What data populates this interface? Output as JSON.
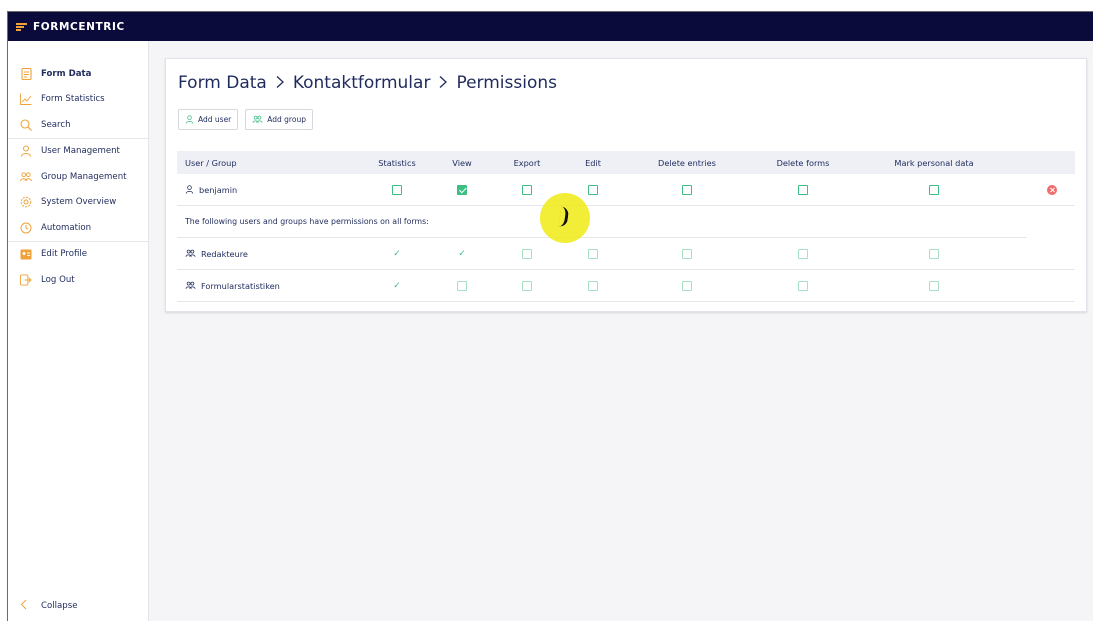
{
  "app": {
    "logo_text": "FORMCENTRIC"
  },
  "sidebar": {
    "items": [
      {
        "label": "Form Data",
        "icon": "form-icon",
        "active": true
      },
      {
        "label": "Form Statistics",
        "icon": "chart-icon"
      },
      {
        "label": "Search",
        "icon": "search-icon"
      },
      {
        "label": "User Management",
        "icon": "user-icon"
      },
      {
        "label": "Group Management",
        "icon": "group-icon"
      },
      {
        "label": "System Overview",
        "icon": "gear-icon"
      },
      {
        "label": "Automation",
        "icon": "clock-icon"
      },
      {
        "label": "Edit Profile",
        "icon": "id-card-icon"
      },
      {
        "label": "Log Out",
        "icon": "logout-icon"
      }
    ],
    "collapse_label": "Collapse"
  },
  "breadcrumb": {
    "part1": "Form Data",
    "part2": "Kontaktformular",
    "part3": "Permissions"
  },
  "toolbar": {
    "add_user": "Add user",
    "add_group": "Add group"
  },
  "table": {
    "headers": [
      "User / Group",
      "Statistics",
      "View",
      "Export",
      "Edit",
      "Delete entries",
      "Delete forms",
      "Mark personal data"
    ],
    "rows": [
      {
        "name": "benjamin",
        "type": "user",
        "perms": [
          false,
          true,
          false,
          false,
          false,
          false,
          false
        ]
      }
    ],
    "note": "The following users and groups have permissions on all forms:",
    "global_rows": [
      {
        "name": "Redakteure",
        "type": "group",
        "perms": [
          true,
          true,
          false,
          false,
          false,
          false,
          false
        ]
      },
      {
        "name": "Formularstatistiken",
        "type": "group",
        "perms": [
          true,
          false,
          false,
          false,
          false,
          false,
          false
        ]
      }
    ]
  },
  "colors": {
    "accent": "#3dbf83",
    "brand": "#0b0b3b",
    "orange": "#f0a23a",
    "danger": "#ef6b6b"
  }
}
